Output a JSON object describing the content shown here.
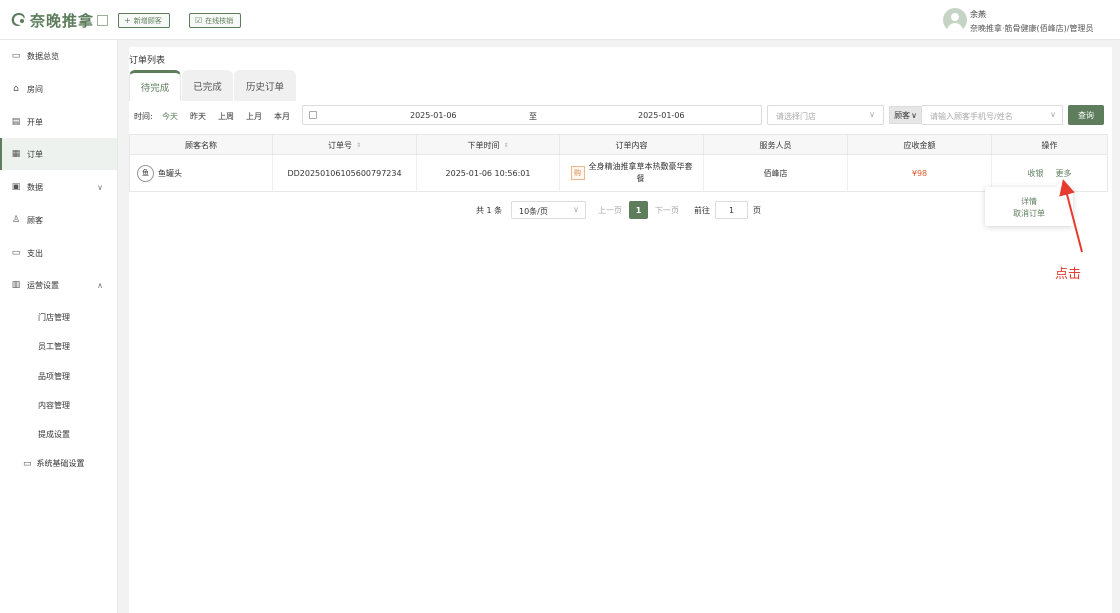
{
  "brand": {
    "name": "奈晚推拿",
    "accent": "#5d7d5c"
  },
  "header": {
    "new_customer": "新增顾客",
    "online_checkout": "在线核销",
    "user_name": "余燕",
    "user_role": "奈晚推拿·筋骨健康(佰峰店)/管理员"
  },
  "sidebar": {
    "items": [
      {
        "label": "数据总览",
        "icon": "monitor-icon"
      },
      {
        "label": "房间",
        "icon": "home-icon"
      },
      {
        "label": "开单",
        "icon": "document-icon"
      },
      {
        "label": "订单",
        "icon": "order-icon"
      },
      {
        "label": "数据",
        "icon": "data-icon"
      },
      {
        "label": "顾客",
        "icon": "user-icon"
      },
      {
        "label": "支出",
        "icon": "wallet-icon"
      },
      {
        "label": "运营设置",
        "icon": "settings-icon"
      }
    ],
    "subitems": [
      "门店管理",
      "员工管理",
      "品项管理",
      "内容管理",
      "提成设置"
    ],
    "system": "系统基础设置"
  },
  "page": {
    "title": "订单列表"
  },
  "tabs": [
    "待完成",
    "已完成",
    "历史订单"
  ],
  "filters": {
    "time_label": "时间:",
    "quick": [
      "今天",
      "昨天",
      "上周",
      "上月",
      "本月"
    ],
    "date_from": "2025-01-06",
    "date_sep": "至",
    "date_to": "2025-01-06",
    "store_placeholder": "请选择门店",
    "customer_type": "顾客",
    "customer_placeholder": "请输入顾客手机号/姓名",
    "query": "查询"
  },
  "table": {
    "headers": [
      "顾客名称",
      "订单号",
      "下单时间",
      "订单内容",
      "服务人员",
      "应收金额",
      "操作"
    ],
    "rows": [
      {
        "avatar": "鱼",
        "name": "鱼罐头",
        "order_no": "DD20250106105600797234",
        "time": "2025-01-06 10:56:01",
        "tag": "购",
        "content": "全身精油推拿草本热敷豪华套餐",
        "staff": "佰峰店",
        "amount": "¥98",
        "action_receive": "收银",
        "action_more": "更多"
      }
    ]
  },
  "pagination": {
    "total": "共 1 条",
    "page_size": "10条/页",
    "prev": "上一页",
    "current": "1",
    "next": "下一页",
    "goto": "前往",
    "goto_value": "1",
    "page_unit": "页"
  },
  "dropdown": {
    "items": [
      "详情",
      "取消订单"
    ]
  },
  "annotation": {
    "text": "点击",
    "color": "#e63b2e"
  }
}
